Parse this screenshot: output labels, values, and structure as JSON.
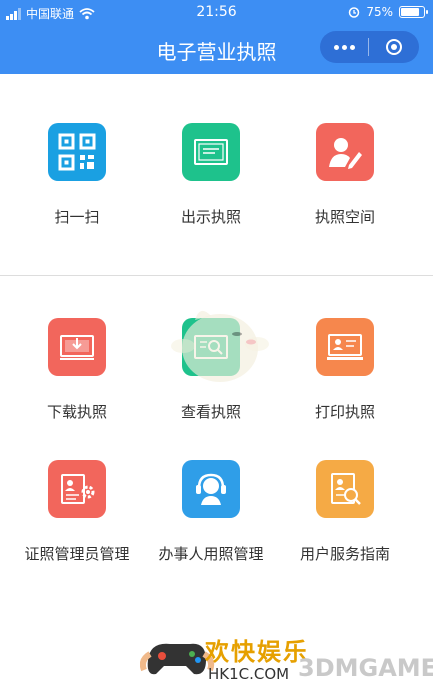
{
  "status_bar": {
    "carrier": "中国联通",
    "time": "21:56",
    "battery": "75%"
  },
  "nav": {
    "title": "电子营业执照"
  },
  "grid": [
    {
      "label": "扫一扫",
      "icon": "qr-scan-icon",
      "color": "#1aa0e2"
    },
    {
      "label": "出示执照",
      "icon": "certificate-icon",
      "color": "#1ec28c"
    },
    {
      "label": "执照空间",
      "icon": "user-edit-icon",
      "color": "#f2665c"
    },
    {
      "label": "下载执照",
      "icon": "download-license-icon",
      "color": "#f2665c"
    },
    {
      "label": "查看执照",
      "icon": "view-license-icon",
      "color": "#1ec28c"
    },
    {
      "label": "打印执照",
      "icon": "print-license-icon",
      "color": "#f6874d"
    },
    {
      "label": "证照管理员管理",
      "icon": "admin-settings-icon",
      "color": "#f2665c"
    },
    {
      "label": "办事人用照管理",
      "icon": "support-agent-icon",
      "color": "#2f9ee8"
    },
    {
      "label": "用户服务指南",
      "icon": "service-guide-icon",
      "color": "#f5aa45"
    }
  ],
  "watermark": {
    "brand_cn": "欢快娱乐",
    "domain": "HK1C.COM",
    "brand_en": "3DMGAME"
  }
}
